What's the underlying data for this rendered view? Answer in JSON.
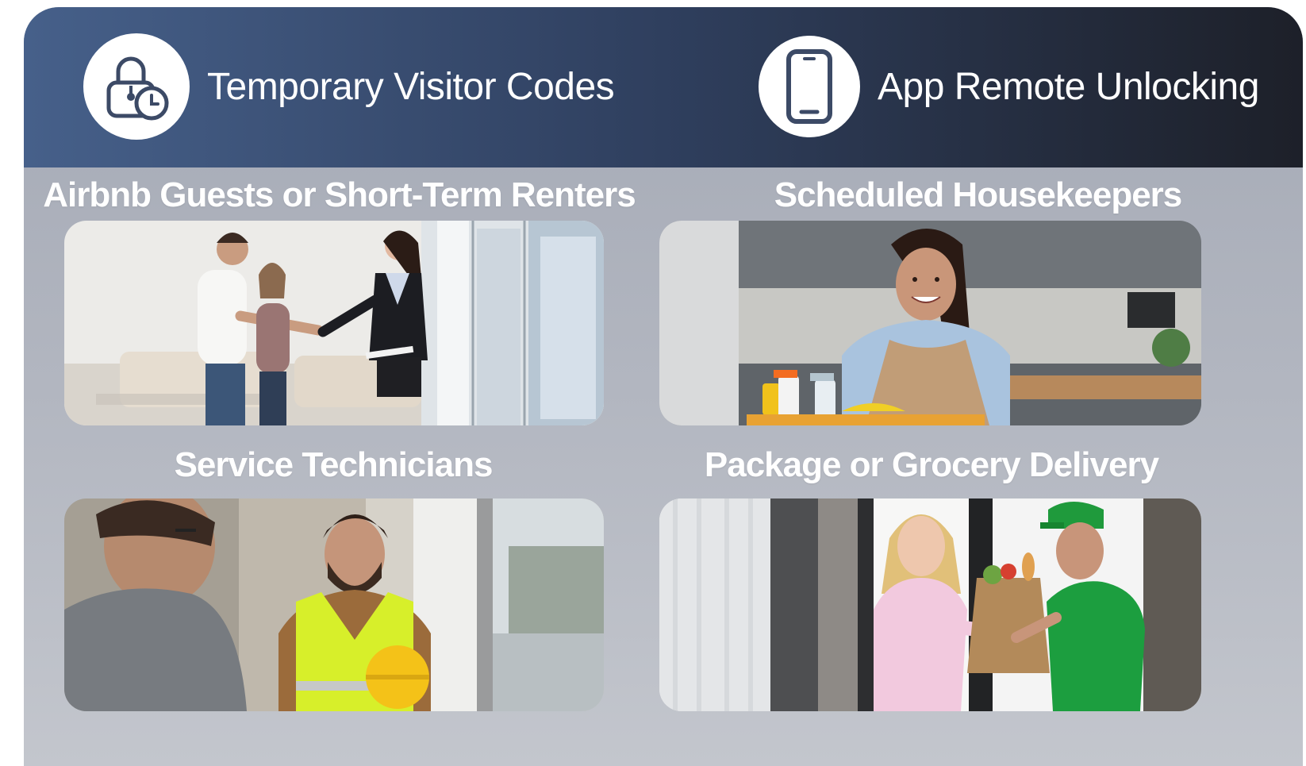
{
  "header": {
    "features": [
      {
        "label": "Temporary Visitor Codes",
        "icon": "lock-clock-icon"
      },
      {
        "label": "App Remote Unlocking",
        "icon": "smartphone-icon"
      }
    ]
  },
  "sections": [
    {
      "title": "Airbnb Guests or Short-Term Renters",
      "photo": "host-greeting-couple-photo"
    },
    {
      "title": "Scheduled Housekeepers",
      "photo": "housekeeper-photo"
    },
    {
      "title": "Service Technicians",
      "photo": "technician-photo"
    },
    {
      "title": "Package or Grocery Delivery",
      "photo": "grocery-delivery-photo"
    }
  ],
  "colors": {
    "header_start": "#46608a",
    "header_end": "#1d2029",
    "panel": "#b2b6c0",
    "icon_stroke": "#3c4a66"
  }
}
